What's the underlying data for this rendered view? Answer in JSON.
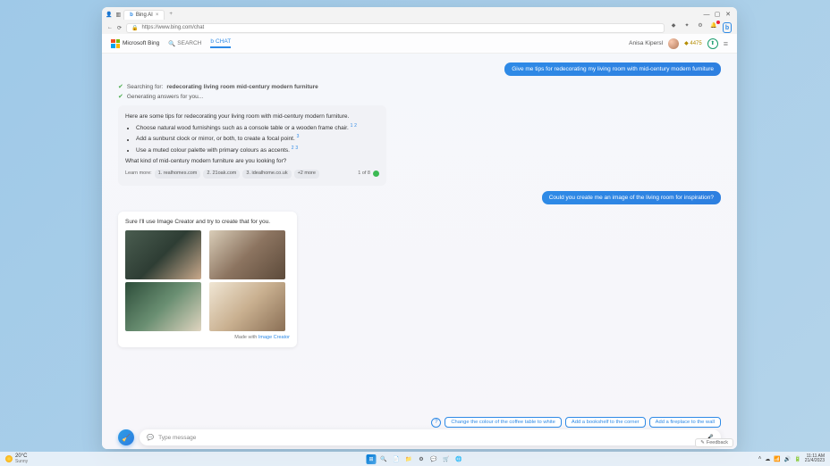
{
  "titlebar": {
    "tab": "Bing AI",
    "plus": "+",
    "min": "—",
    "max": "▢",
    "close": "✕"
  },
  "url": {
    "lock": "🔒",
    "text": "https://www.bing.com/chat"
  },
  "uricons": {
    "a": "◆",
    "b": "✦",
    "c": "⚙",
    "d": "☰",
    "badge": "b"
  },
  "header": {
    "logo": "Microsoft Bing",
    "search": "SEARCH",
    "chat": "CHAT",
    "user": "Anisa Kipersl",
    "points": "4475",
    "safe": "⬆"
  },
  "chat": {
    "user1": "Give me tips for redecorating my living room with mid-century modern furniture",
    "search_label": "Searching for:",
    "search_q": "redecorating living room mid-century modern furniture",
    "gen": "Generating answers for you...",
    "intro": "Here are some tips for redecorating your living room with mid-century modern furniture.",
    "tips": [
      "Choose natural wood furnishings such as a console table or a wooden frame chair.",
      "Add a sunburst clock or mirror, or both, to create a focal point.",
      "Use a muted colour palette with primary colours as accents."
    ],
    "outro": "What kind of mid-century modern furniture are you looking for?",
    "learn": "Learn more:",
    "srcs": [
      "1. realhomes.com",
      "2. 21oak.com",
      "3. idealhome.co.uk",
      "+2 more"
    ],
    "count": "1 of 8",
    "user2": "Could you create me an image of the living room for inspiration?",
    "imgresp": "Sure I'll use Image Creator and try to create that for you.",
    "made_pre": "Made with ",
    "made_link": "Image Creator",
    "suggest": [
      "Change the colour of the coffee table to white",
      "Add a bookshelf to the corner",
      "Add a fireplace to the wall"
    ],
    "placeholder": "Type message",
    "feedback": "Feedback"
  },
  "taskbar": {
    "temp": "20°C",
    "cond": "Sunny",
    "apps": [
      "⊞",
      "🔍",
      "📄",
      "📁",
      "⚙",
      "💬",
      "🛒",
      "🌐"
    ],
    "time": "11:11 AM",
    "date": "21/4/2023"
  }
}
